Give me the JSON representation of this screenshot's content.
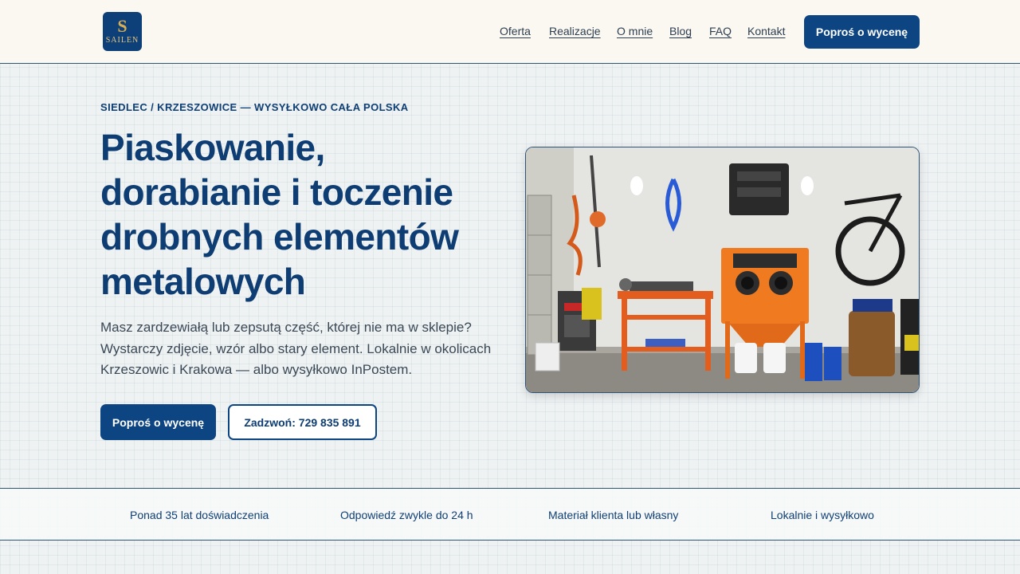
{
  "header": {
    "logo": {
      "letter": "S",
      "word": "SAILEN"
    },
    "nav": [
      {
        "label": "Oferta"
      },
      {
        "label": "Realizacje"
      },
      {
        "label": "O mnie"
      },
      {
        "label": "Blog"
      },
      {
        "label": "FAQ"
      },
      {
        "label": "Kontakt"
      }
    ],
    "cta_label": "Poproś o wycenę"
  },
  "hero": {
    "eyebrow": "SIEDLEC / KRZESZOWICE — WYSYŁKOWO CAŁA POLSKA",
    "title": "Piaskowanie, dorabianie i toczenie drobnych elementów metalowych",
    "description": "Masz zardzewiałą lub zepsutą część, której nie ma w sklepie? Wystarczy zdjęcie, wzór albo stary element. Lokalnie w okolicach Krzeszowic i Krakowa — albo wysyłkowo InPostem.",
    "primary_button": "Poproś o wycenę",
    "secondary_button": "Zadzwoń: 729 835 891"
  },
  "features": [
    {
      "label": "Ponad 35 lat doświadczenia"
    },
    {
      "label": "Odpowiedź zwykle do 24 h"
    },
    {
      "label": "Materiał klienta lub własny"
    },
    {
      "label": "Lokalnie i wysyłkowo"
    }
  ],
  "colors": {
    "brand": "#0d4583",
    "heading": "#0d3d72",
    "header_bg": "#fbf8f1",
    "logo_gold": "#d8ae55"
  }
}
